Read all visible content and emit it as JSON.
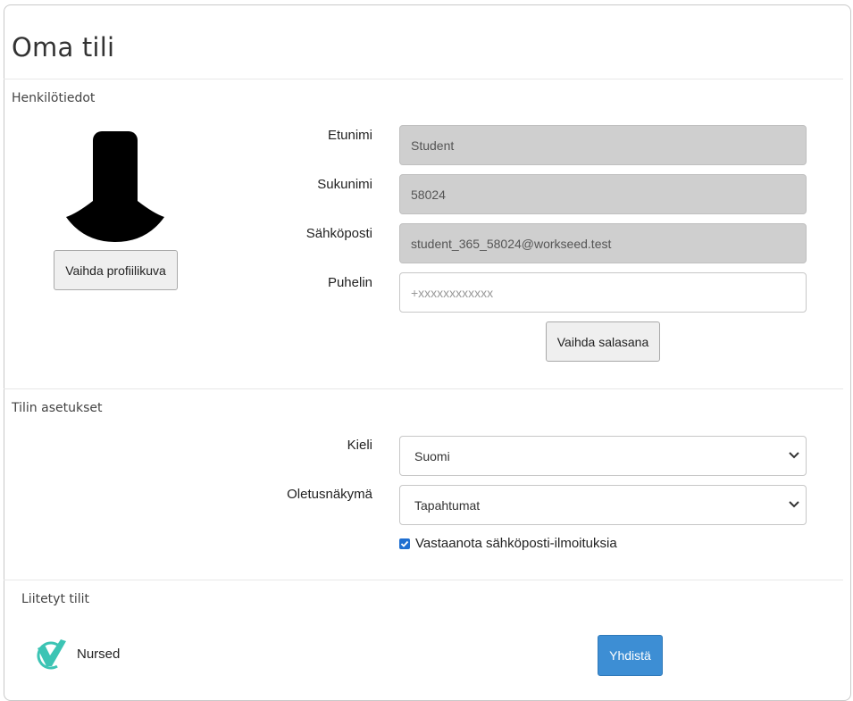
{
  "page": {
    "title": "Oma tili"
  },
  "personal": {
    "section_title": "Henkilötiedot",
    "change_picture_label": "Vaihda profiilikuva",
    "fields": {
      "first_name": {
        "label": "Etunimi",
        "value": "Student"
      },
      "last_name": {
        "label": "Sukunimi",
        "value": "58024"
      },
      "email": {
        "label": "Sähköposti",
        "value": "student_365_58024@workseed.test"
      },
      "phone": {
        "label": "Puhelin",
        "value": "",
        "placeholder": "+xxxxxxxxxxxx"
      }
    },
    "change_password_label": "Vaihda salasana"
  },
  "settings": {
    "section_title": "Tilin asetukset",
    "language": {
      "label": "Kieli",
      "selected": "Suomi"
    },
    "default_view": {
      "label": "Oletusnäkymä",
      "selected": "Tapahtumat"
    },
    "email_notifications": {
      "label": "Vastaanota sähköposti-ilmoituksia",
      "checked": true
    }
  },
  "linked": {
    "section_title": "Liitetyt tilit",
    "accounts": [
      {
        "name": "Nursed",
        "icon": "nursed-logo-icon",
        "action_label": "Yhdistä"
      }
    ]
  },
  "colors": {
    "primary": "#3d8ed4",
    "readonly_bg": "#cfcfcf",
    "logo_teal": "#3cc4b4"
  }
}
